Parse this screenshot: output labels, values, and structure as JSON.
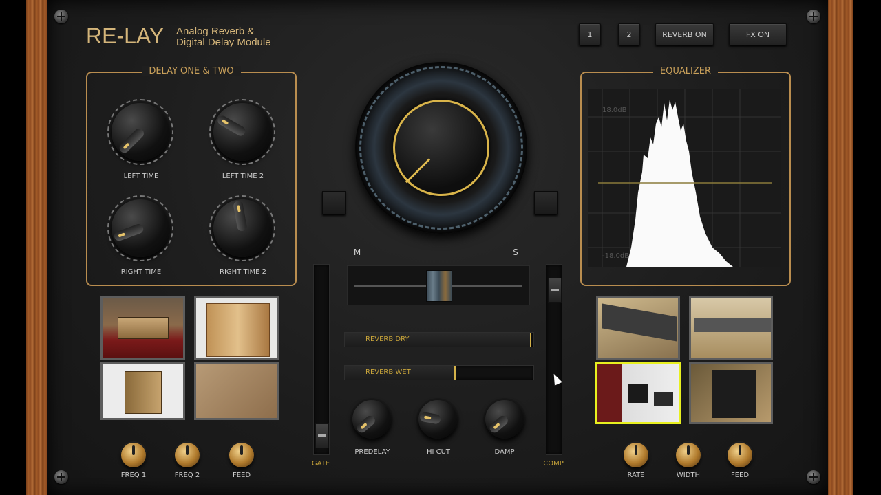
{
  "header": {
    "logo": "RE-LAY",
    "subtitle_line1": "Analog Reverb &",
    "subtitle_line2": "Digital Delay Module",
    "buttons": [
      "1",
      "2",
      "REVERB ON",
      "FX ON"
    ]
  },
  "delay_panel": {
    "title": "DELAY ONE & TWO",
    "knobs": [
      {
        "label": "LEFT TIME",
        "angle": -135
      },
      {
        "label": "LEFT TIME 2",
        "angle": -60
      },
      {
        "label": "RIGHT TIME",
        "angle": -110
      },
      {
        "label": "RIGHT TIME 2",
        "angle": -10
      }
    ]
  },
  "equalizer": {
    "title": "EQUALIZER",
    "top_label": "18.0dB",
    "bottom_label": "-18.0dB"
  },
  "center": {
    "mid_label": "M",
    "side_label": "S",
    "reverb_dry_label": "REVERB DRY",
    "reverb_dry_level": 0.98,
    "reverb_wet_label": "REVERB WET",
    "reverb_wet_level": 0.58,
    "gate_label": "GATE",
    "gate_level": 0.03,
    "comp_label": "COMP",
    "comp_level": 0.93,
    "ms_position": 0.5,
    "knobs": [
      {
        "label": "PREDELAY",
        "angle": -130
      },
      {
        "label": "HI CUT",
        "angle": -80
      },
      {
        "label": "DAMP",
        "angle": -130
      }
    ]
  },
  "left_knobs": [
    "FREQ 1",
    "FREQ 2",
    "FEED"
  ],
  "right_knobs": [
    "RATE",
    "WIDTH",
    "FEED"
  ]
}
